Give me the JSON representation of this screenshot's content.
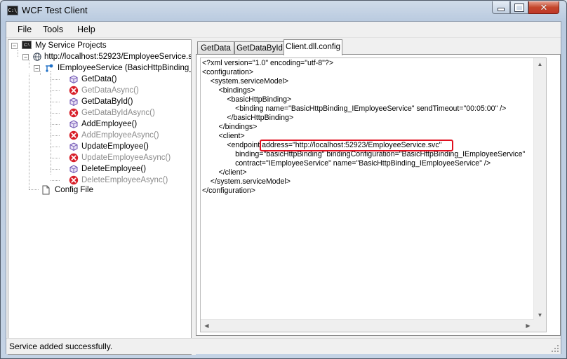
{
  "window": {
    "title": "WCF Test Client",
    "icon_text": "C:\\"
  },
  "menu": [
    "File",
    "Tools",
    "Help"
  ],
  "tree": {
    "root": "My Service Projects",
    "service": "http://localhost:52923/EmployeeService.s",
    "contract": "IEmployeeService (BasicHttpBinding_",
    "operations": [
      {
        "name": "GetData()",
        "enabled": true
      },
      {
        "name": "GetDataAsync()",
        "enabled": false
      },
      {
        "name": "GetDataById()",
        "enabled": true
      },
      {
        "name": "GetDataByIdAsync()",
        "enabled": false
      },
      {
        "name": "AddEmployee()",
        "enabled": true
      },
      {
        "name": "AddEmployeeAsync()",
        "enabled": false
      },
      {
        "name": "UpdateEmployee()",
        "enabled": true
      },
      {
        "name": "UpdateEmployeeAsync()",
        "enabled": false
      },
      {
        "name": "DeleteEmployee()",
        "enabled": true
      },
      {
        "name": "DeleteEmployeeAsync()",
        "enabled": false
      }
    ],
    "config_file": "Config File"
  },
  "tabs": [
    {
      "label": "GetData",
      "active": false
    },
    {
      "label": "GetDataById",
      "active": false
    },
    {
      "label": "Client.dll.config",
      "active": true
    }
  ],
  "config_xml": [
    "<?xml version=\"1.0\" encoding=\"utf-8\"?>",
    "<configuration>",
    "    <system.serviceModel>",
    "        <bindings>",
    "            <basicHttpBinding>",
    "                <binding name=\"BasicHttpBinding_IEmployeeService\" sendTimeout=\"00:05:00\" />",
    "            </basicHttpBinding>",
    "        </bindings>",
    "        <client>",
    "            <endpoint address=\"http://localhost:52923/EmployeeService.svc\"",
    "                binding=\"basicHttpBinding\" bindingConfiguration=\"BasicHttpBinding_IEmployeeService\"",
    "                contract=\"IEmployeeService\" name=\"BasicHttpBinding_IEmployeeService\" />",
    "        </client>",
    "    </system.serviceModel>",
    "</configuration>"
  ],
  "status": "Service added successfully.",
  "colors": {
    "highlight_box": "#e0101f",
    "disabled_text": "#8b8b8b",
    "error_icon": "#d8202a"
  }
}
